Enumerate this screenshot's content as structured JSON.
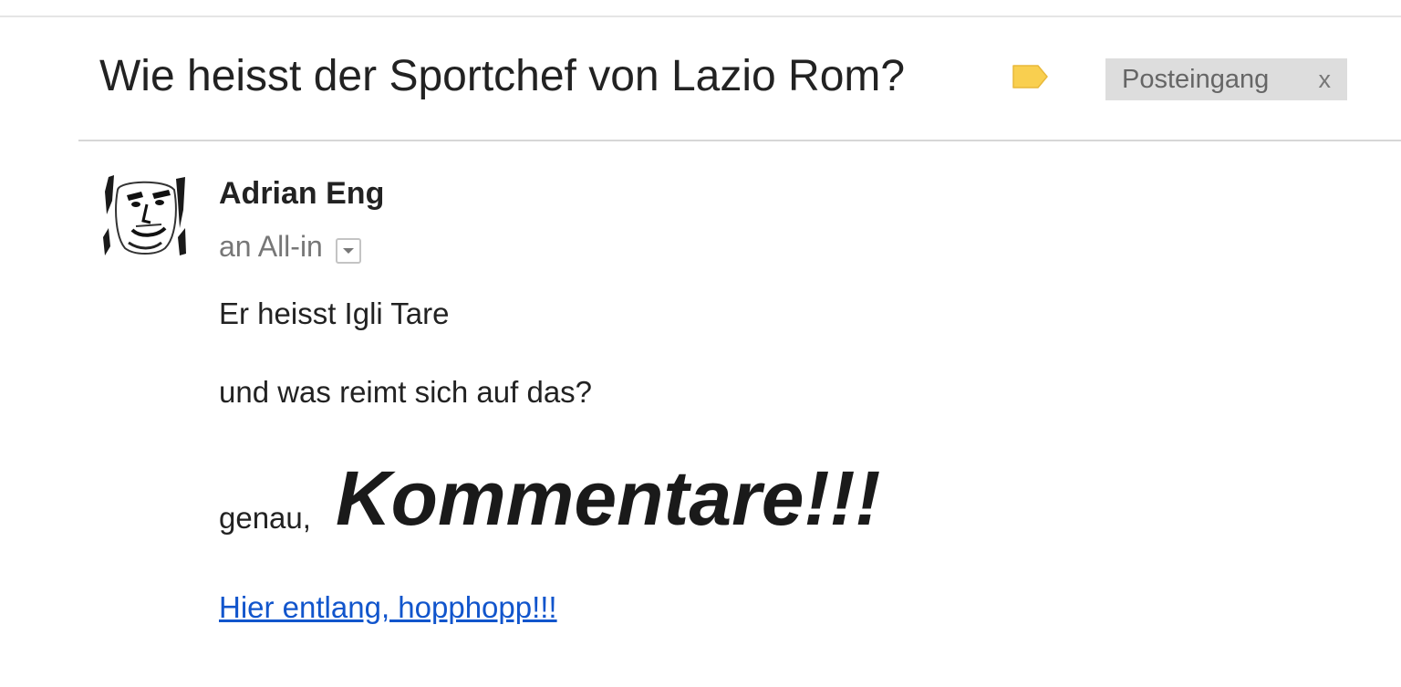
{
  "email": {
    "subject": "Wie heisst der Sportchef von Lazio Rom?",
    "label_color": "#f9cf4f",
    "inbox_chip": {
      "label": "Posteingang",
      "close": "x"
    },
    "sender": {
      "name": "Adrian Eng",
      "recipient": "an All-in",
      "avatar_icon": "person-portrait-avatar"
    },
    "body": {
      "line1": "Er heisst Igli Tare",
      "line2": "und was reimt sich auf das?",
      "line3_small": "genau,",
      "line3_big": "Kommentare!!!",
      "link_text": "Hier entlang, hopphopp!!!"
    }
  }
}
